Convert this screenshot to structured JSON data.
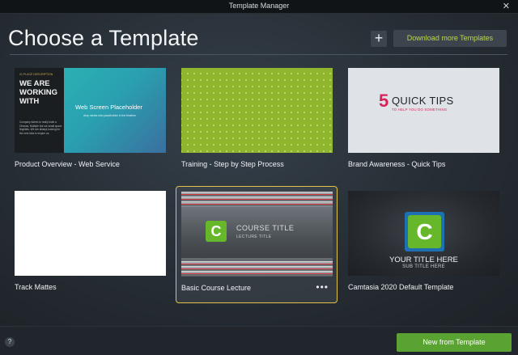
{
  "window": {
    "title": "Template Manager",
    "close_glyph": "✕"
  },
  "header": {
    "title": "Choose a Template",
    "add_glyph": "+",
    "download_label": "Download more Templates"
  },
  "templates": [
    {
      "name": "Product Overview - Web Service",
      "thumb": {
        "tag": "01   PLACE DESCRIPTION",
        "headline": "WE ARE WORKING WITH",
        "body": "Company Admin to really build a Ohanas. Multiple but our small space finghbits. We are always looking for the next idea to inspire us.",
        "placeholder_title": "Web Screen Placeholder",
        "placeholder_sub": "drop media onto placeholder in the timeline"
      }
    },
    {
      "name": "Training - Step by Step Process"
    },
    {
      "name": "Brand Awareness - Quick Tips",
      "thumb": {
        "number": "5",
        "title": "QUICK TIPS",
        "subtitle": "TO HELP YOU DO SOMETHING"
      }
    },
    {
      "name": "Track Mattes"
    },
    {
      "name": "Basic Course Lecture",
      "selected": true,
      "more_glyph": "•••",
      "thumb": {
        "logo": "C",
        "course_title": "COURSE TITLE",
        "lecture_title": "LECTURE TITLE"
      }
    },
    {
      "name": "Camtasia 2020 Default Template",
      "thumb": {
        "logo": "C",
        "title": "YOUR TITLE HERE",
        "subtitle": "SUB TITLE HERE"
      }
    }
  ],
  "footer": {
    "help_glyph": "?",
    "new_label": "New from Template"
  },
  "colors": {
    "accent_green": "#5aa332",
    "download_text": "#b8d84e",
    "selection_border": "#e2c34a",
    "brand_pink": "#d6245b"
  }
}
